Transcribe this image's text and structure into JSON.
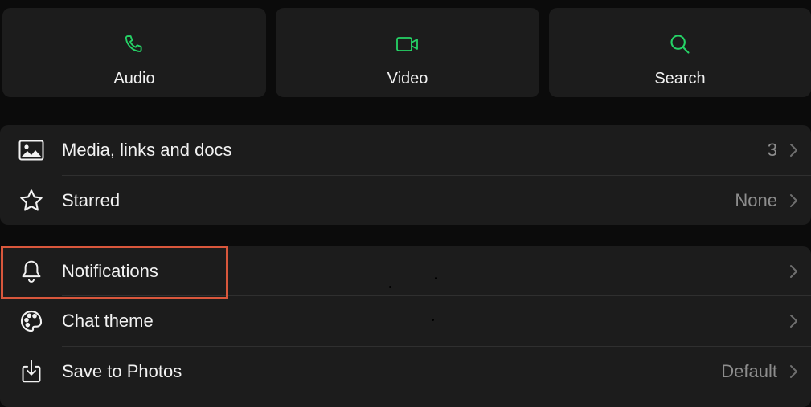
{
  "quick_actions": [
    {
      "label": "Audio",
      "icon": "phone-icon"
    },
    {
      "label": "Video",
      "icon": "video-camera-icon"
    },
    {
      "label": "Search",
      "icon": "search-icon"
    }
  ],
  "media_group": [
    {
      "title": "Media, links and docs",
      "value": "3",
      "icon": "image-icon"
    },
    {
      "title": "Starred",
      "value": "None",
      "icon": "star-icon"
    }
  ],
  "settings_group": [
    {
      "title": "Notifications",
      "value": "",
      "icon": "bell-icon"
    },
    {
      "title": "Chat theme",
      "value": "",
      "icon": "palette-icon"
    },
    {
      "title": "Save to Photos",
      "value": "Default",
      "icon": "download-icon"
    }
  ],
  "colors": {
    "accent_green": "#25d366",
    "background": "#0b0b0b",
    "card": "#1c1c1c",
    "highlight": "#d9573c"
  }
}
